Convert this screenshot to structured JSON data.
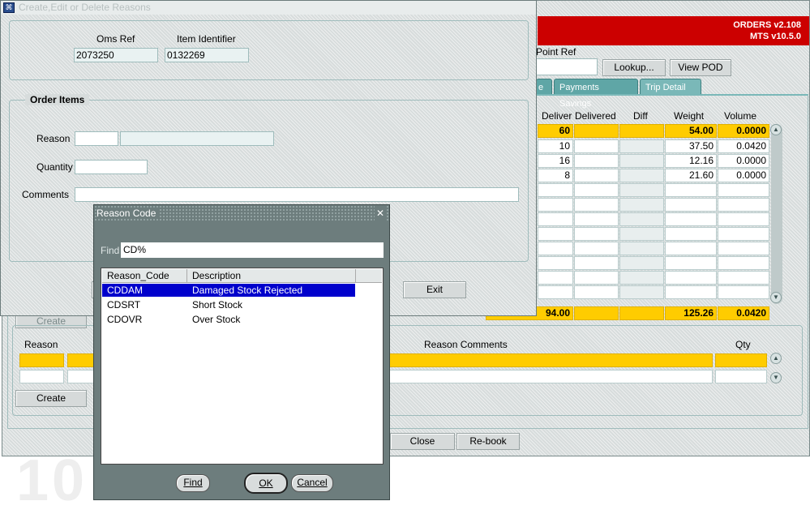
{
  "bg_watermark": "10",
  "main": {
    "version1": "ORDERS v2.108",
    "version2": "MTS v10.5.0",
    "point_ref_label": "Point Ref",
    "lookup_btn": "Lookup...",
    "view_pod_btn": "View POD",
    "tabs": [
      "e",
      "Payments Savings",
      "Trip Detail"
    ],
    "grid_headers": [
      "Deliver",
      "Delivered",
      "Diff",
      "Weight",
      "Volume"
    ],
    "grid_total_row": [
      "60",
      "",
      "",
      "54.00",
      "0.0000"
    ],
    "grid_rows": [
      [
        "10",
        "",
        "",
        "37.50",
        "0.0420"
      ],
      [
        "16",
        "",
        "",
        "12.16",
        "0.0000"
      ],
      [
        "8",
        "",
        "",
        "21.60",
        "0.0000"
      ]
    ],
    "grid_footer": [
      "94.00",
      "",
      "",
      "125.26",
      "0.0420"
    ],
    "create_top": "Create",
    "reason_header": "Reason",
    "reason_comments_header": "Reason Comments",
    "qty_header": "Qty",
    "create_bottom": "Create",
    "close_btn": "Close",
    "rebook_btn": "Re-book"
  },
  "cedr": {
    "title": "Create,Edit or Delete Reasons",
    "oms_ref_label": "Oms Ref",
    "oms_ref_value": "2073250",
    "item_id_label": "Item Identifier",
    "item_id_value": "0132269",
    "order_items": "Order Items",
    "reason_label": "Reason",
    "quantity_label": "Quantity",
    "comments_label": "Comments",
    "exit_btn": "Exit"
  },
  "lov": {
    "title": "Reason Code",
    "close": "✕",
    "find_label": "Find",
    "find_value": "CD%",
    "columns": [
      "Reason_Code",
      "Description"
    ],
    "rows": [
      {
        "code": "CDDAM",
        "desc": "Damaged Stock Rejected"
      },
      {
        "code": "CDSRT",
        "desc": "Short Stock"
      },
      {
        "code": "CDOVR",
        "desc": "Over Stock"
      }
    ],
    "find_btn": "Find",
    "ok_btn": "OK",
    "cancel_btn": "Cancel"
  },
  "colors": {
    "header_red": "#cc0000",
    "highlight_yellow": "#ffcc00",
    "selection_blue": "#0000cc",
    "tab_teal": "#5fa6a6",
    "dialog_gray": "#6d7d7d"
  }
}
